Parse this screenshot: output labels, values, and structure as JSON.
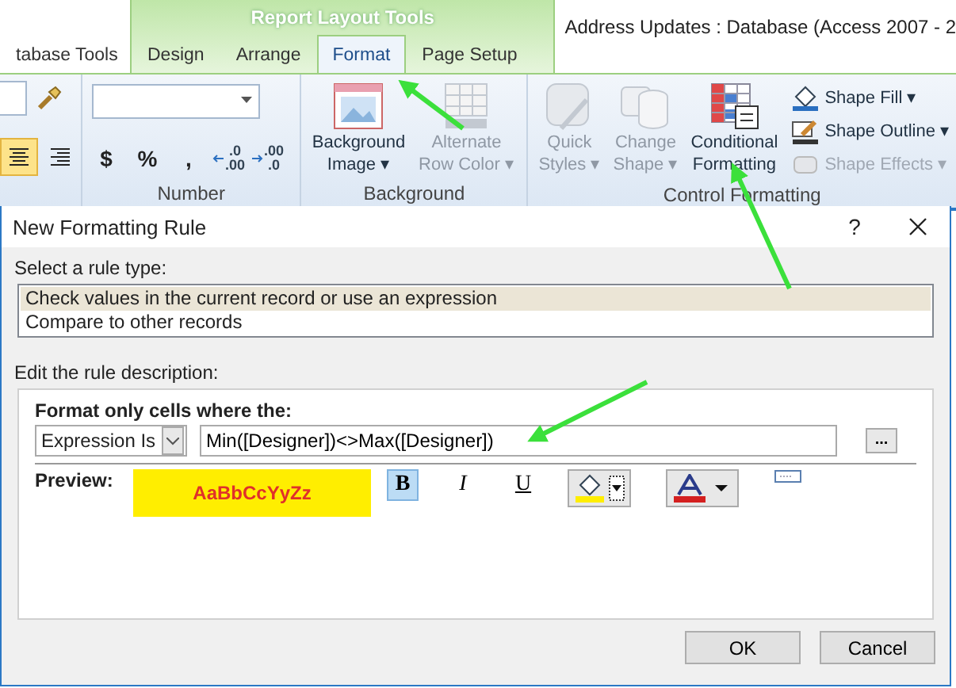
{
  "window": {
    "title": "Address Updates : Database (Access 2007 - 2",
    "contextual_title": "Report Layout Tools"
  },
  "tabs": [
    {
      "label": "tabase Tools",
      "selected": false
    },
    {
      "label": "Design",
      "selected": false
    },
    {
      "label": "Arrange",
      "selected": false
    },
    {
      "label": "Format",
      "selected": true
    },
    {
      "label": "Page Setup",
      "selected": false
    }
  ],
  "ribbon": {
    "align_buttons": [
      {
        "kind": "center",
        "selected": true
      },
      {
        "kind": "right",
        "selected": false
      }
    ],
    "number_group": {
      "label": "Number",
      "buttons": [
        "$",
        "%",
        ","
      ],
      "decimal_buttons": [
        {
          "kind": "increase",
          "top": ".0",
          "bottom": ".00"
        },
        {
          "kind": "decrease",
          "top": ".00",
          "bottom": ".0"
        }
      ]
    },
    "background_group": {
      "label": "Background",
      "buttons": [
        {
          "kind": "image",
          "lines": [
            "Background",
            "Image ▾"
          ],
          "disabled": false
        },
        {
          "kind": "grid",
          "lines": [
            "Alternate",
            "Row Color ▾"
          ],
          "disabled": true
        }
      ]
    },
    "control_group": {
      "label": "Control Formatting",
      "large_buttons": [
        {
          "kind": "quick",
          "lines": [
            "Quick",
            "Styles ▾"
          ],
          "disabled": true
        },
        {
          "kind": "shape",
          "lines": [
            "Change",
            "Shape ▾"
          ],
          "disabled": true
        },
        {
          "kind": "conditional",
          "lines": [
            "Conditional",
            "Formatting"
          ],
          "disabled": false
        }
      ],
      "small_buttons": [
        {
          "kind": "fill",
          "label": "Shape Fill ▾",
          "disabled": false
        },
        {
          "kind": "outline",
          "label": "Shape Outline ▾",
          "disabled": false
        },
        {
          "kind": "effects",
          "label": "Shape Effects ▾",
          "disabled": true
        }
      ]
    }
  },
  "dialog": {
    "title": "New Formatting Rule",
    "help": "?",
    "rule_type_label": "Select a rule type:",
    "rule_types": [
      {
        "label": "Check values in the current record or use an expression",
        "selected": true
      },
      {
        "label": "Compare to other records",
        "selected": false
      }
    ],
    "description_label": "Edit the rule description:",
    "condition_heading": "Format only cells where the:",
    "condition": "Expression Is",
    "expression": "Min([Designer])<>Max([Designer])",
    "builder_button": "...",
    "preview_label": "Preview:",
    "preview_sample": "AaBbCcYyZz",
    "format_buttons": [
      {
        "label": "B",
        "kind": "bold",
        "selected": true
      },
      {
        "label": "I",
        "kind": "italic",
        "selected": false
      },
      {
        "label": "U",
        "kind": "underline",
        "selected": false
      }
    ],
    "buttons": [
      "OK",
      "Cancel"
    ]
  }
}
